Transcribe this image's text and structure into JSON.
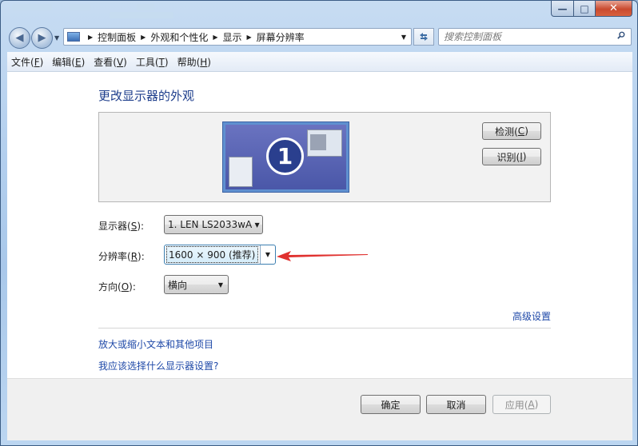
{
  "titlebar": {
    "controls": {
      "minimize": "—",
      "maximize": "□",
      "close": "✕"
    }
  },
  "nav": {
    "back_icon": "◀",
    "forward_icon": "▶",
    "breadcrumbs": [
      "控制面板",
      "外观和个性化",
      "显示",
      "屏幕分辨率"
    ],
    "refresh_icon": "refresh-icon",
    "search_placeholder": "搜索控制面板"
  },
  "menubar": {
    "items": [
      {
        "label": "文件(",
        "key": "F",
        "end": ")"
      },
      {
        "label": "编辑(",
        "key": "E",
        "end": ")"
      },
      {
        "label": "查看(",
        "key": "V",
        "end": ")"
      },
      {
        "label": "工具(",
        "key": "T",
        "end": ")"
      },
      {
        "label": "帮助(",
        "key": "H",
        "end": ")"
      }
    ]
  },
  "page": {
    "title": "更改显示器的外观",
    "monitor_number": "1",
    "detect_button": {
      "label": "检测(",
      "key": "C",
      "end": ")"
    },
    "identify_button": {
      "label": "识别(",
      "key": "I",
      "end": ")"
    },
    "display": {
      "label": "显示器(",
      "key": "S",
      "end": "):",
      "value": "1. LEN LS2033wA"
    },
    "resolution": {
      "label": "分辨率(",
      "key": "R",
      "end": "):",
      "value": "1600 × 900 (推荐)"
    },
    "orientation": {
      "label": "方向(",
      "key": "O",
      "end": "):",
      "value": "横向"
    },
    "advanced_link": "高级设置",
    "link_text_size": "放大或缩小文本和其他项目",
    "link_which_settings": "我应该选择什么显示器设置?"
  },
  "footer": {
    "ok": "确定",
    "cancel": "取消",
    "apply": {
      "label": "应用(",
      "key": "A",
      "end": ")"
    }
  },
  "colors": {
    "annotation_arrow": "#e0312f",
    "link": "#1f49a8",
    "title": "#1e3e8c"
  }
}
